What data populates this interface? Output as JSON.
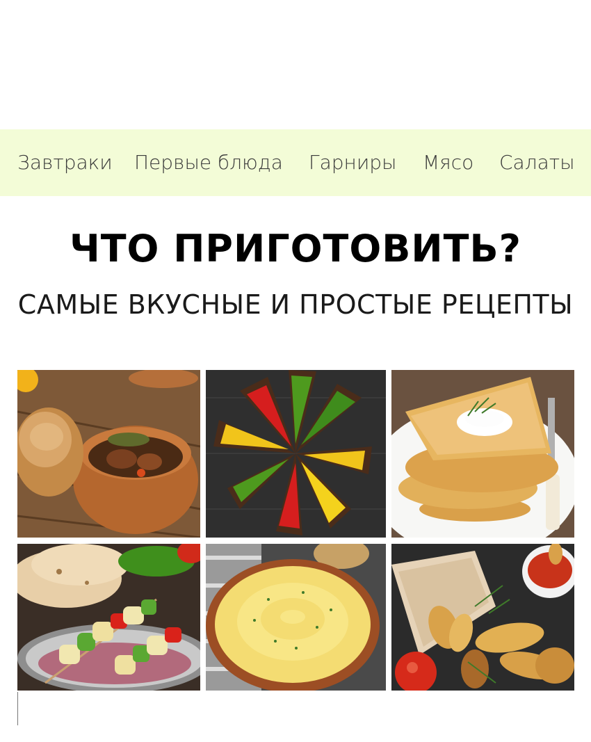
{
  "nav": {
    "items": [
      {
        "label": "Завтраки"
      },
      {
        "label": "Первые блюда"
      },
      {
        "label": "Гарниры"
      },
      {
        "label": "Мясо"
      },
      {
        "label": "Салаты"
      }
    ],
    "background": "#f3fcd7"
  },
  "header": {
    "title": "ЧТО ПРИГОТОВИТЬ?",
    "subtitle": "САМЫЕ ВКУСНЫЕ И ПРОСТЫЕ РЕЦЕПТЫ"
  },
  "gallery": {
    "tiles": [
      {
        "name": "photo-stew-in-pot"
      },
      {
        "name": "photo-pepper-toasts"
      },
      {
        "name": "photo-potato-pancakes"
      },
      {
        "name": "photo-chicken-kebab"
      },
      {
        "name": "photo-mashed-potatoes"
      },
      {
        "name": "photo-baked-potato-wedges"
      }
    ]
  }
}
